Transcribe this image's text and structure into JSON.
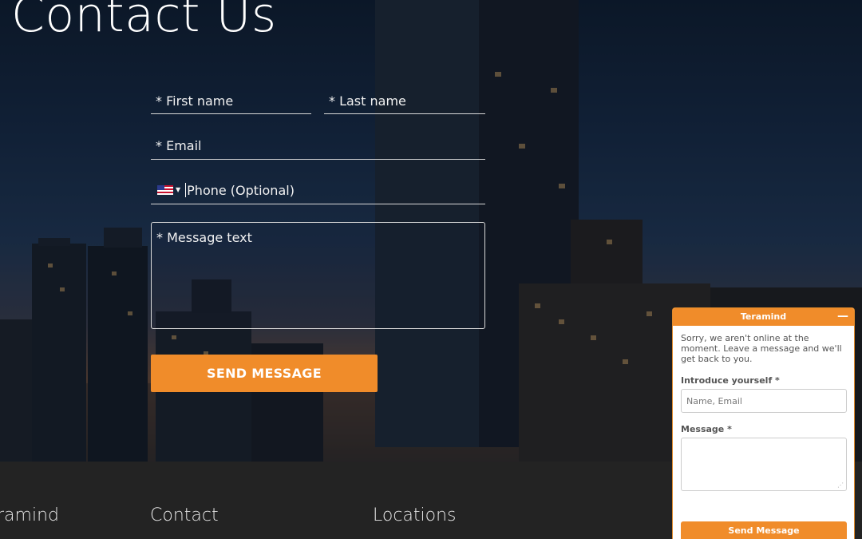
{
  "page": {
    "title": "Contact Us"
  },
  "form": {
    "first_name_placeholder": "* First name",
    "last_name_placeholder": "* Last name",
    "email_placeholder": "* Email",
    "phone_placeholder": "Phone (Optional)",
    "message_placeholder": "* Message text",
    "send_label": "SEND MESSAGE",
    "phone_country_icon": "us-flag-icon"
  },
  "footer": {
    "columns": [
      "ramind",
      "Contact",
      "Locations"
    ]
  },
  "chat": {
    "title": "Teramind",
    "minimize_symbol": "—",
    "intro": "Sorry, we aren't online at the moment. Leave a message and we'll get back to you.",
    "introduce_label": "Introduce yourself *",
    "introduce_placeholder": "Name, Email",
    "message_label": "Message *",
    "send_label": "Send Message"
  },
  "colors": {
    "accent": "#f08c2a",
    "footer_bg": "#232323"
  }
}
